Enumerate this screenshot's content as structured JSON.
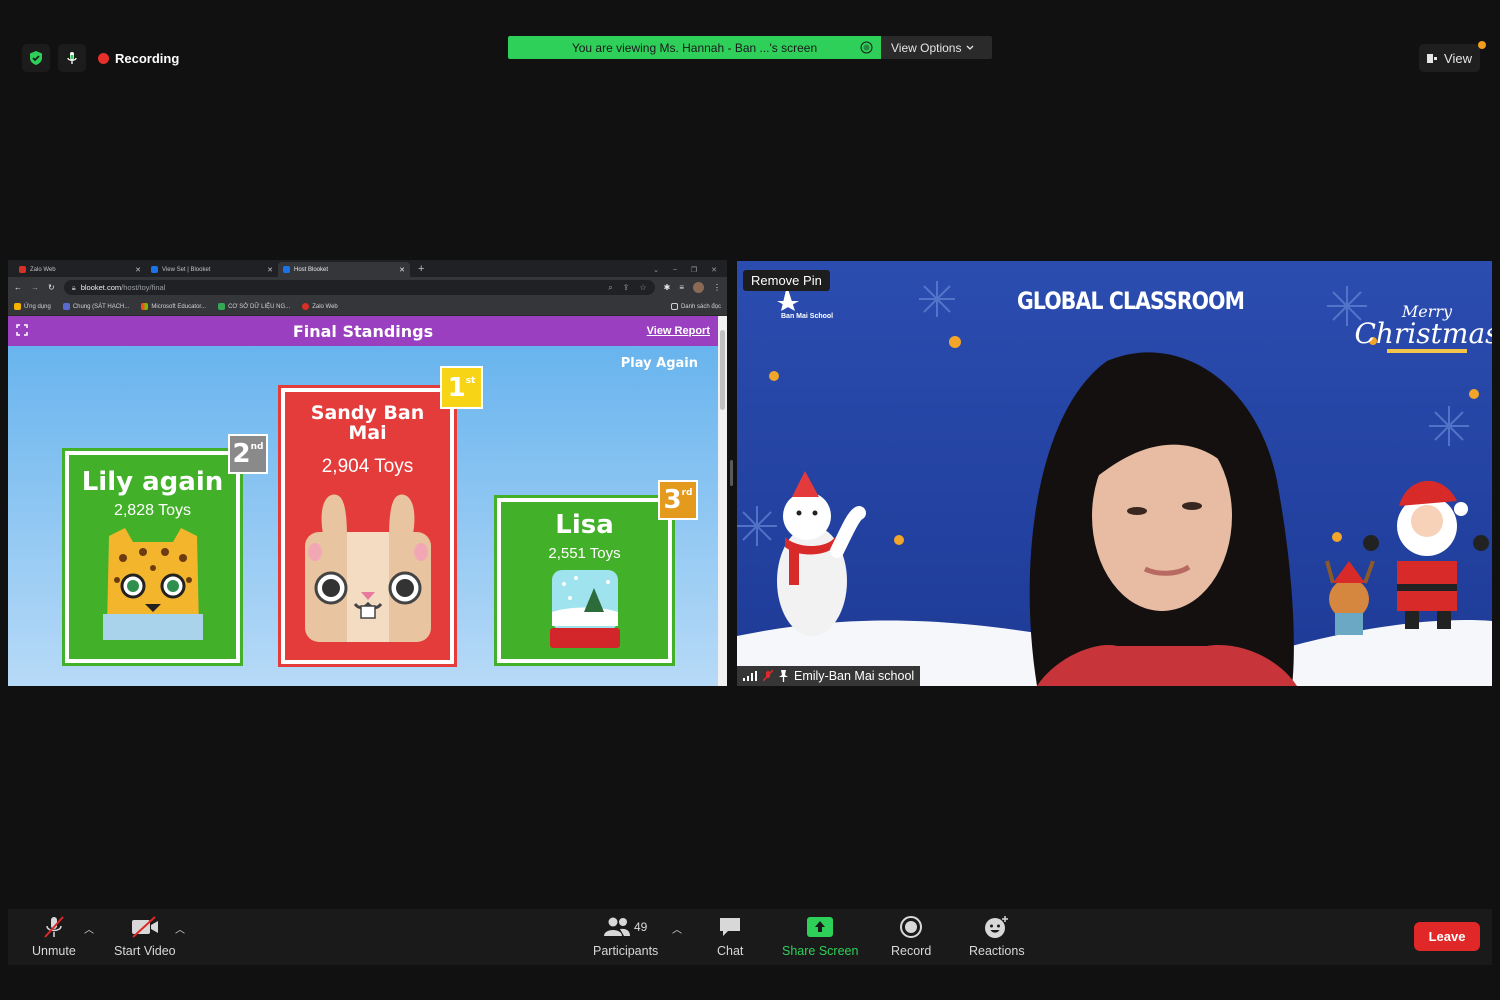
{
  "top": {
    "recording_label": "Recording",
    "viewing_banner": "You are viewing Ms. Hannah - Ban ...'s screen",
    "view_options_label": "View Options",
    "view_label": "View"
  },
  "browser": {
    "tabs": [
      {
        "label": "Zalo Web",
        "color": "#d93025"
      },
      {
        "label": "View Set | Blooket",
        "color": "#1a73e8"
      },
      {
        "label": "Host Blooket",
        "color": "#1a73e8"
      }
    ],
    "url_host": "blooket.com",
    "url_path": "/host/toy/final",
    "bookmarks": [
      "Ứng dụng",
      "Chung (SÁT HẠCH...",
      "Microsoft Educator...",
      "CƠ SỞ DỮ LIỆU NG...",
      "Zalo Web"
    ],
    "reading_list": "Danh sách đọc"
  },
  "blooket": {
    "title": "Final Standings",
    "view_report": "View Report",
    "play_again": "Play Again",
    "standings": [
      {
        "place": "1",
        "suffix": "st",
        "name": "Sandy Ban Mai",
        "score": "2,904 Toys",
        "character": "bunny"
      },
      {
        "place": "2",
        "suffix": "nd",
        "name": "Lily again",
        "score": "2,828 Toys",
        "character": "leopard"
      },
      {
        "place": "3",
        "suffix": "rd",
        "name": "Lisa",
        "score": "2,551 Toys",
        "character": "snow-globe"
      }
    ]
  },
  "webcam": {
    "remove_pin": "Remove Pin",
    "banner_title": "GLOBAL CLASSROOM",
    "school_logo": "Ban Mai School",
    "participant_name": "Emily-Ban Mai school"
  },
  "toolbar": {
    "unmute": "Unmute",
    "start_video": "Start Video",
    "participants": "Participants",
    "participants_count": "49",
    "chat": "Chat",
    "share_screen": "Share Screen",
    "record": "Record",
    "reactions": "Reactions",
    "leave": "Leave"
  },
  "colors": {
    "accent_green": "#2ed05a",
    "leave_red": "#e02828",
    "blooket_purple": "#9a3fc0"
  }
}
